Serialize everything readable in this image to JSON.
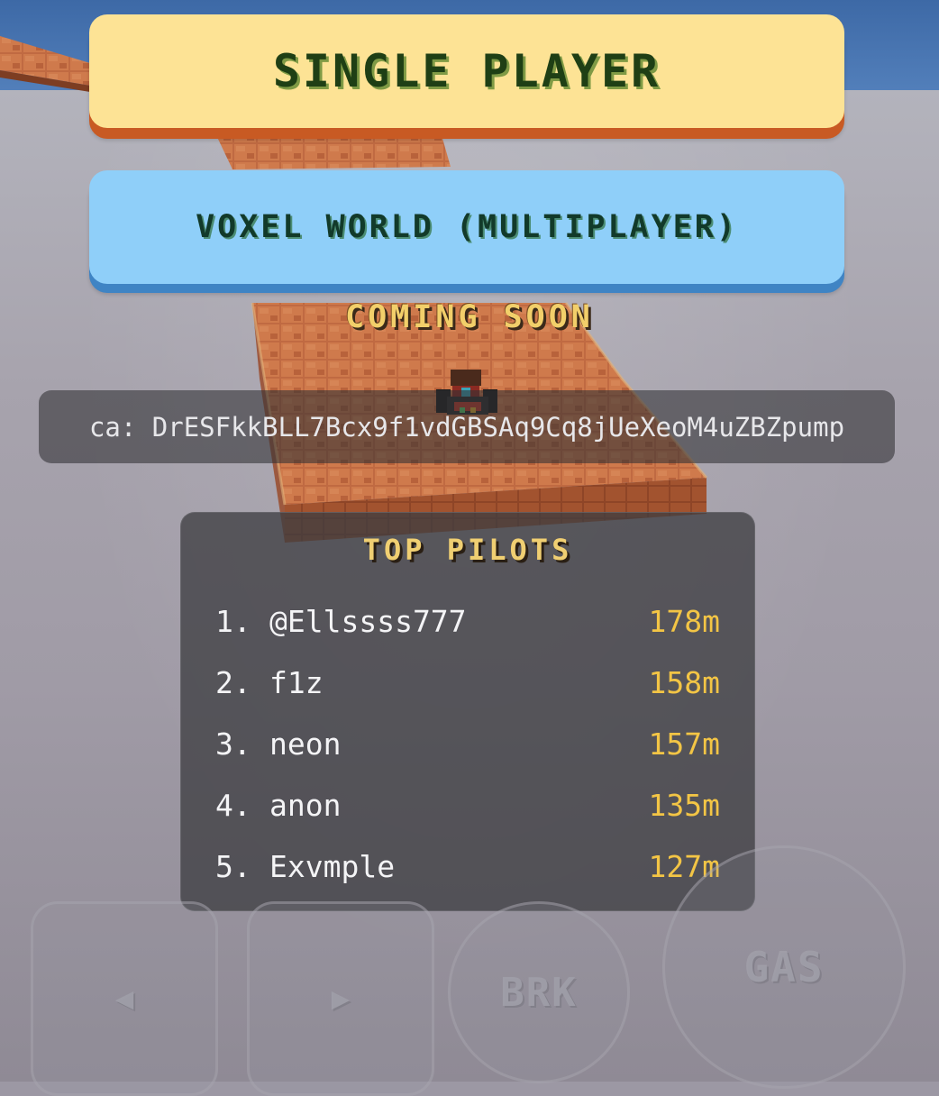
{
  "menu": {
    "single_player_label": "SINGLE PLAYER",
    "multiplayer_label": "VOXEL WORLD (MULTIPLAYER)",
    "coming_soon": "COMING SOON"
  },
  "contract": {
    "text": "ca: DrESFkkBLL7Bcx9f1vdGBSAq9Cq8jUeXeoM4uZBZpump"
  },
  "leaderboard": {
    "title": "TOP PILOTS",
    "entries": [
      {
        "rank": "1.",
        "name": "@Ellssss777",
        "distance": "178m"
      },
      {
        "rank": "2.",
        "name": "f1z",
        "distance": "158m"
      },
      {
        "rank": "3.",
        "name": "neon",
        "distance": "157m"
      },
      {
        "rank": "4.",
        "name": "anon",
        "distance": "135m"
      },
      {
        "rank": "5.",
        "name": "Exvmple",
        "distance": "127m"
      }
    ]
  },
  "controls": {
    "left": "◀",
    "right": "▶",
    "brake": "BRK",
    "gas": "GAS"
  },
  "colors": {
    "single_player_bg": "#fde395",
    "multiplayer_bg": "#8fcff9",
    "accent_yellow": "#f3c545",
    "track_brick": "#b8623d"
  }
}
